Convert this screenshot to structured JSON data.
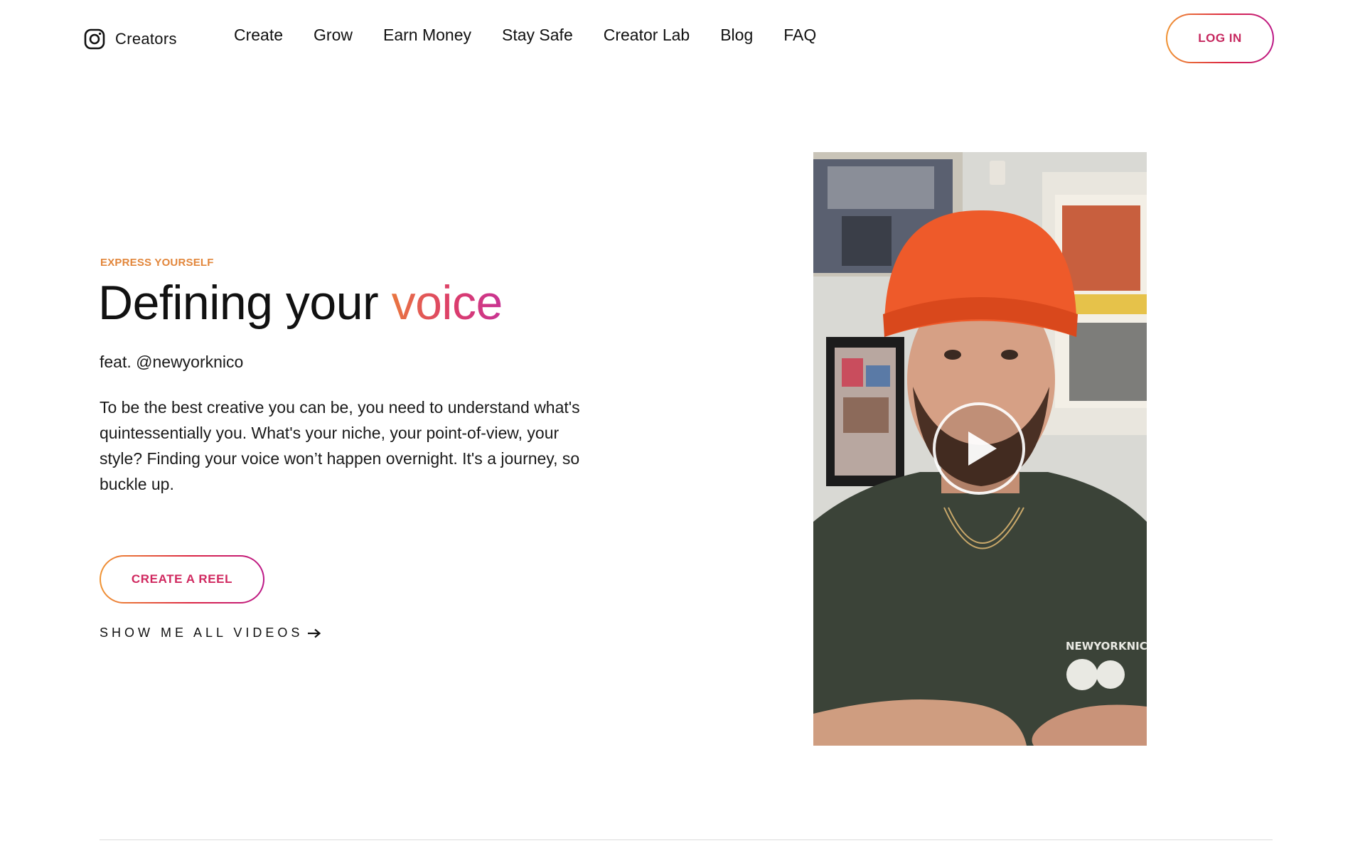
{
  "header": {
    "brand_label": "Creators",
    "nav": [
      "Create",
      "Grow",
      "Earn Money",
      "Stay Safe",
      "Creator Lab",
      "Blog",
      "FAQ"
    ],
    "login_label": "LOG IN"
  },
  "hero": {
    "eyebrow": "EXPRESS YOURSELF",
    "title_main": "Defining your ",
    "title_accent": "voice",
    "feat": "feat. @newyorknico",
    "body": "To be the best creative you can be, you need to understand what's quintessentially you. What's your niche, your point-of-view, your style? Finding your voice won’t happen overnight. It's a journey, so buckle up.",
    "cta_label": "CREATE A REEL",
    "show_all_label": "SHOW ME ALL VIDEOS"
  },
  "video": {
    "shirt_text": "NEWYORKNICO",
    "play_icon": "play-icon"
  },
  "colors": {
    "accent_orange": "#e2863b",
    "accent_pink": "#d0285f",
    "gradient": [
      "#f09433",
      "#dc2743",
      "#bc1888"
    ]
  },
  "icons": {
    "brand": "instagram-icon",
    "show_all": "arrow-right-icon"
  }
}
